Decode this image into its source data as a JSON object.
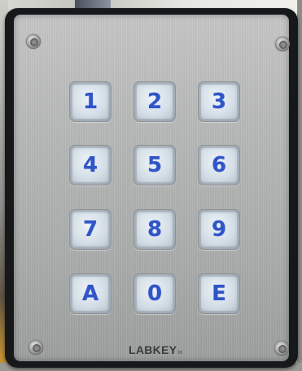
{
  "keypad": {
    "keys": [
      {
        "label": "1"
      },
      {
        "label": "2"
      },
      {
        "label": "3"
      },
      {
        "label": "4"
      },
      {
        "label": "5"
      },
      {
        "label": "6"
      },
      {
        "label": "7"
      },
      {
        "label": "8"
      },
      {
        "label": "9"
      },
      {
        "label": "A"
      },
      {
        "label": "0"
      },
      {
        "label": "E"
      }
    ],
    "key_text_color": "#3055c8",
    "plate_color": "#b7b8b8",
    "frame_color": "#17181a"
  },
  "brand": {
    "name": "LABKEY",
    "suffix": "io"
  }
}
